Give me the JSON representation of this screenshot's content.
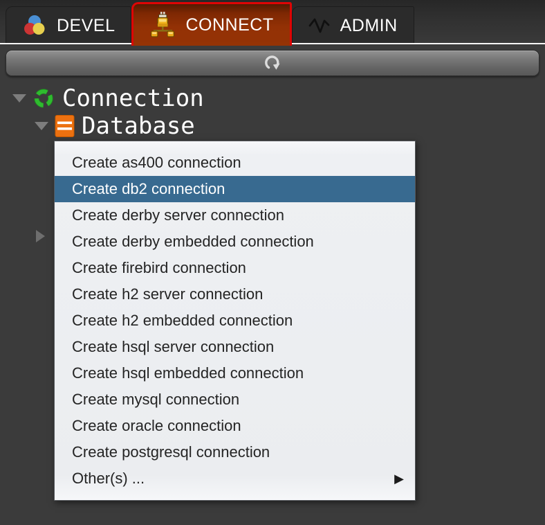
{
  "tabs": [
    {
      "label": "DEVEL",
      "icon": "palette-icon",
      "active": false
    },
    {
      "label": "CONNECT",
      "icon": "connector-icon",
      "active": true
    },
    {
      "label": "ADMIN",
      "icon": "pulse-icon",
      "active": false
    }
  ],
  "toolbar": {
    "refresh_icon": "refresh-icon"
  },
  "tree": {
    "items": [
      {
        "label": "Connection",
        "icon": "connection-ring-icon",
        "expanded": true
      },
      {
        "label": "Database",
        "icon": "database-icon",
        "expanded": true
      }
    ],
    "collapsed_node_present": true
  },
  "context_menu": {
    "submenu_arrow": "▶",
    "items": [
      {
        "label": "Create as400 connection",
        "selected": false
      },
      {
        "label": "Create db2 connection",
        "selected": true
      },
      {
        "label": "Create derby server connection",
        "selected": false
      },
      {
        "label": "Create derby embedded connection",
        "selected": false
      },
      {
        "label": "Create firebird connection",
        "selected": false
      },
      {
        "label": "Create h2 server connection",
        "selected": false
      },
      {
        "label": "Create h2 embedded connection",
        "selected": false
      },
      {
        "label": "Create hsql server connection",
        "selected": false
      },
      {
        "label": "Create hsql embedded connection",
        "selected": false
      },
      {
        "label": "Create mysql connection",
        "selected": false
      },
      {
        "label": "Create oracle connection",
        "selected": false
      },
      {
        "label": "Create postgresql connection",
        "selected": false
      },
      {
        "label": "Other(s) ...",
        "selected": false,
        "has_submenu": true
      }
    ]
  },
  "colors": {
    "background": "#3b3b3b",
    "active_tab": "#953305",
    "active_tab_border": "#de0505",
    "menu_background": "#ebedf0",
    "menu_highlight": "#386a90",
    "tree_text": "#ffffff",
    "database_icon_orange": "#ed7110",
    "connection_icon_green": "#2db92d"
  }
}
